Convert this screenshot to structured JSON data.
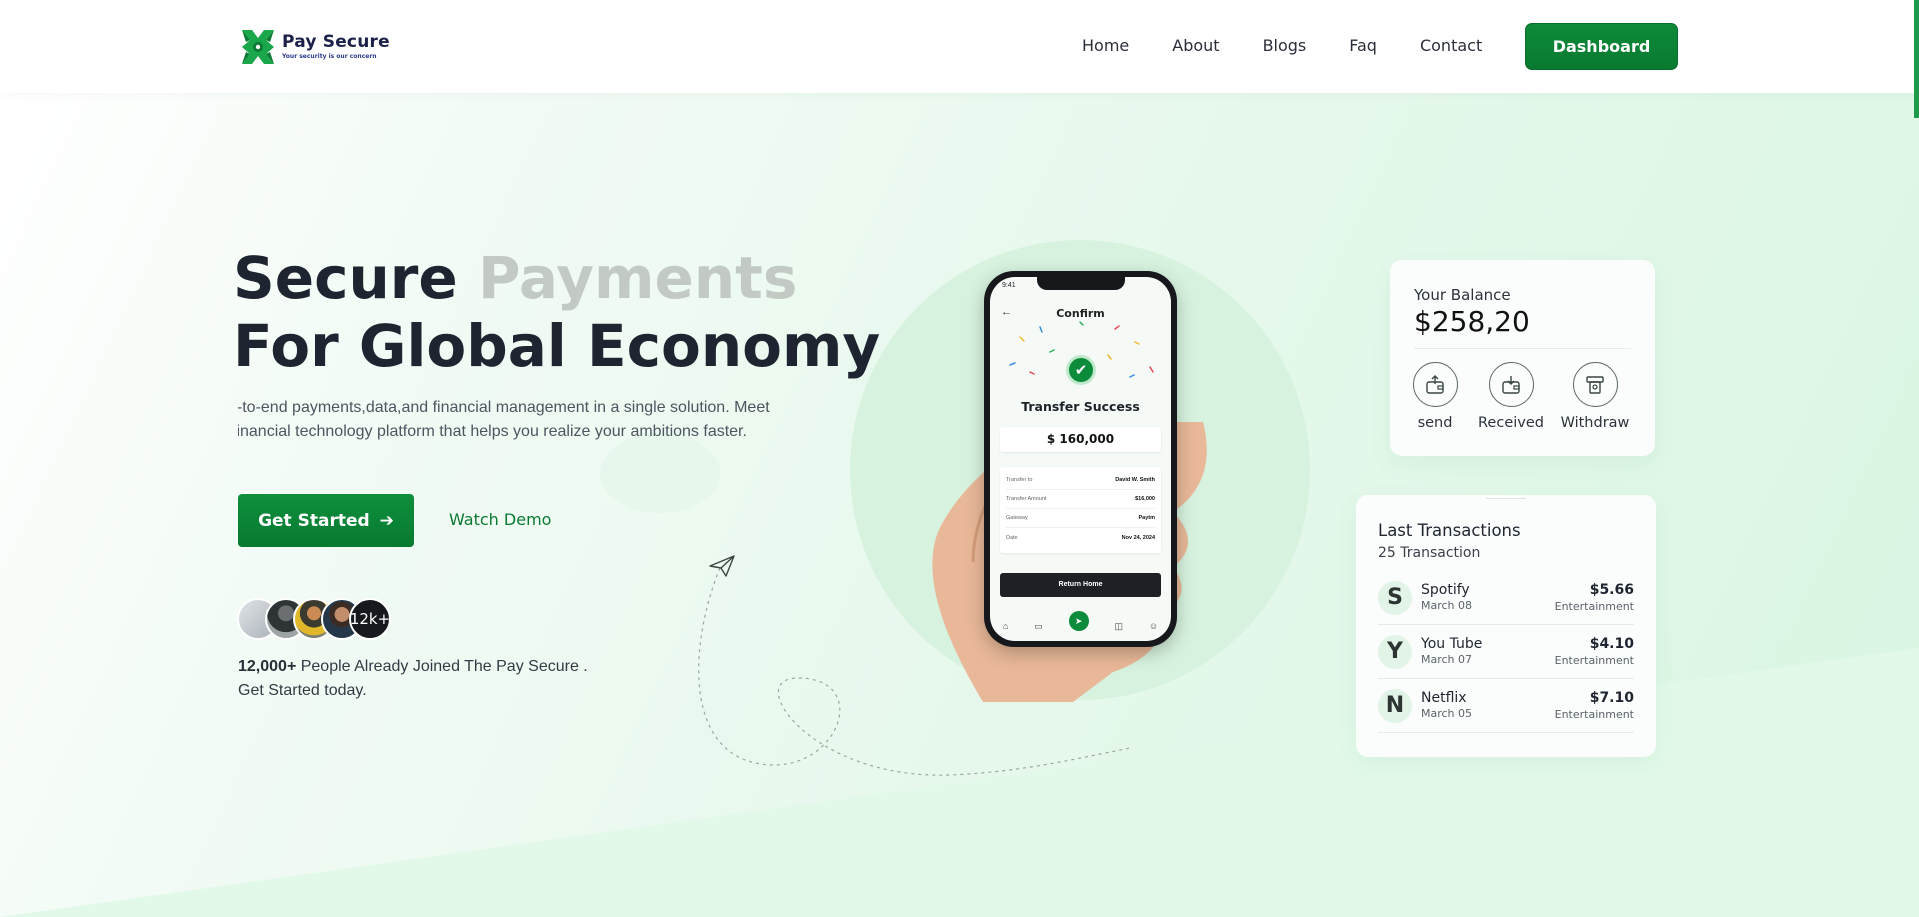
{
  "header": {
    "logo_name": "Pay Secure",
    "logo_tagline": "Your security is our concern",
    "nav": [
      "Home",
      "About",
      "Blogs",
      "Faq",
      "Contact"
    ],
    "dashboard_label": "Dashboard"
  },
  "hero": {
    "title_line1_word1": "Secure",
    "title_line1_word2": "Payments",
    "title_line2": "For Global Economy",
    "desc_line1": "d-to-end payments,data,and financial management in a single solution. Meet",
    "desc_line2": "financial technology platform that helps you realize your ambitions faster.",
    "start_label": "Get Started",
    "demo_label": "Watch Demo",
    "joined_count_badge": "12k+",
    "joined_bold": "12,000+",
    "joined_text": "People Already Joined The Pay Secure .",
    "joined_line2": "Get Started today."
  },
  "phone": {
    "status_time": "9:41",
    "title": "Confirm",
    "success": "Transfer Success",
    "amount": "$ 160,000",
    "details": [
      {
        "label": "Transfer to",
        "value": "David W. Smith"
      },
      {
        "label": "Transfer Amount",
        "value": "$16,000"
      },
      {
        "label": "Gateway",
        "value": "Paytm"
      },
      {
        "label": "Date",
        "value": "Nov 24, 2024"
      }
    ],
    "return_label": "Return Home"
  },
  "balance": {
    "label": "Your Balance",
    "value": "$258,20",
    "actions": [
      {
        "label": "send",
        "icon": "wallet-send-icon"
      },
      {
        "label": "Received",
        "icon": "wallet-receive-icon"
      },
      {
        "label": "Withdraw",
        "icon": "withdraw-icon"
      }
    ]
  },
  "transactions": {
    "title": "Last Transactions",
    "count": "25 Transaction",
    "items": [
      {
        "initial": "S",
        "name": "Spotify",
        "date": "March 08",
        "amount": "$5.66",
        "category": "Entertainment"
      },
      {
        "initial": "Y",
        "name": "You Tube",
        "date": "March 07",
        "amount": "$4.10",
        "category": "Entertainment"
      },
      {
        "initial": "N",
        "name": "Netflix",
        "date": "March 05",
        "amount": "$7.10",
        "category": "Entertainment"
      }
    ]
  },
  "colors": {
    "brand_green": "#0b8a3a",
    "dark_text": "#1f2530",
    "faded_title": "#c3cac4",
    "hero_bg": "#e6f8ec"
  }
}
